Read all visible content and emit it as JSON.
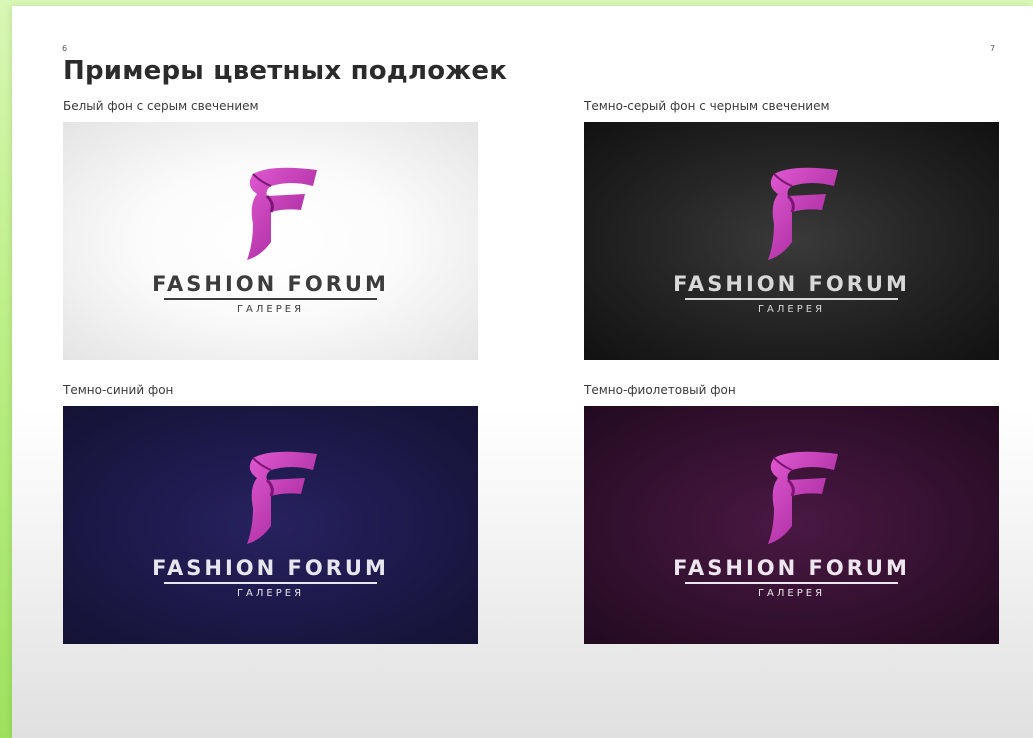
{
  "page_numbers": {
    "left": "6",
    "right": "7"
  },
  "title": "Примеры цветных подложек",
  "panels": [
    {
      "caption": "Белый фон с серым свечением",
      "brand": "FASHION FORUM",
      "subtitle": "ГАЛЕРЕЯ",
      "background": "#ffffff",
      "glow": "#e4e4e4"
    },
    {
      "caption": "Темно-серый фон с черным свечением",
      "brand": "FASHION FORUM",
      "subtitle": "ГАЛЕРЕЯ",
      "background": "#3a3a3a",
      "glow": "#111111"
    },
    {
      "caption": "Темно-синий фон",
      "brand": "FASHION FORUM",
      "subtitle": "ГАЛЕРЕЯ",
      "background": "#1e1a4d",
      "glow": "#141234"
    },
    {
      "caption": "Темно-фиолетовый фон",
      "brand": "FASHION FORUM",
      "subtitle": "ГАЛЕРЕЯ",
      "background": "#381234",
      "glow": "#220a20"
    }
  ],
  "colors": {
    "logo_magenta": "#c93ab8",
    "logo_magenta_dark": "#8e1f86",
    "page_background": "#ffffff",
    "frame_green": "#9de25f"
  },
  "icons": {
    "logo_mark": "ribbon-f-logo-icon"
  }
}
